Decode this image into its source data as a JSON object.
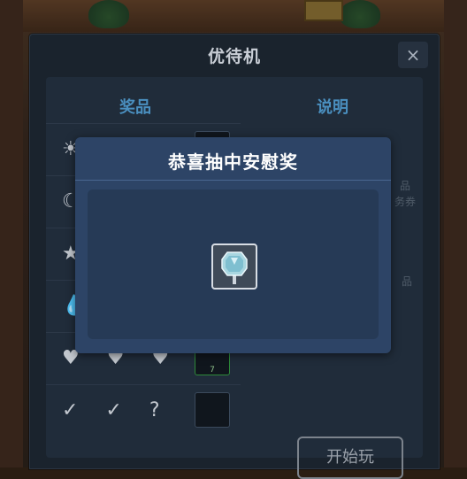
{
  "dialog": {
    "title": "优待机",
    "close_label": "×",
    "prize_header": "奖品",
    "desc_header": "说明",
    "prize_rows": [
      {
        "symbols": "☀"
      },
      {
        "symbols": "☾"
      },
      {
        "symbols": "★"
      },
      {
        "symbols": "💧"
      },
      {
        "symbols": "♥ ♥ ♥",
        "qty": "7"
      },
      {
        "symbols": "✓ ✓ ?"
      }
    ],
    "desc_fragments": [
      "品",
      "务券",
      "品"
    ],
    "start_button": "开始玩"
  },
  "popup": {
    "title": "恭喜抽中安慰奖",
    "reward_icon": "gem-icon"
  }
}
